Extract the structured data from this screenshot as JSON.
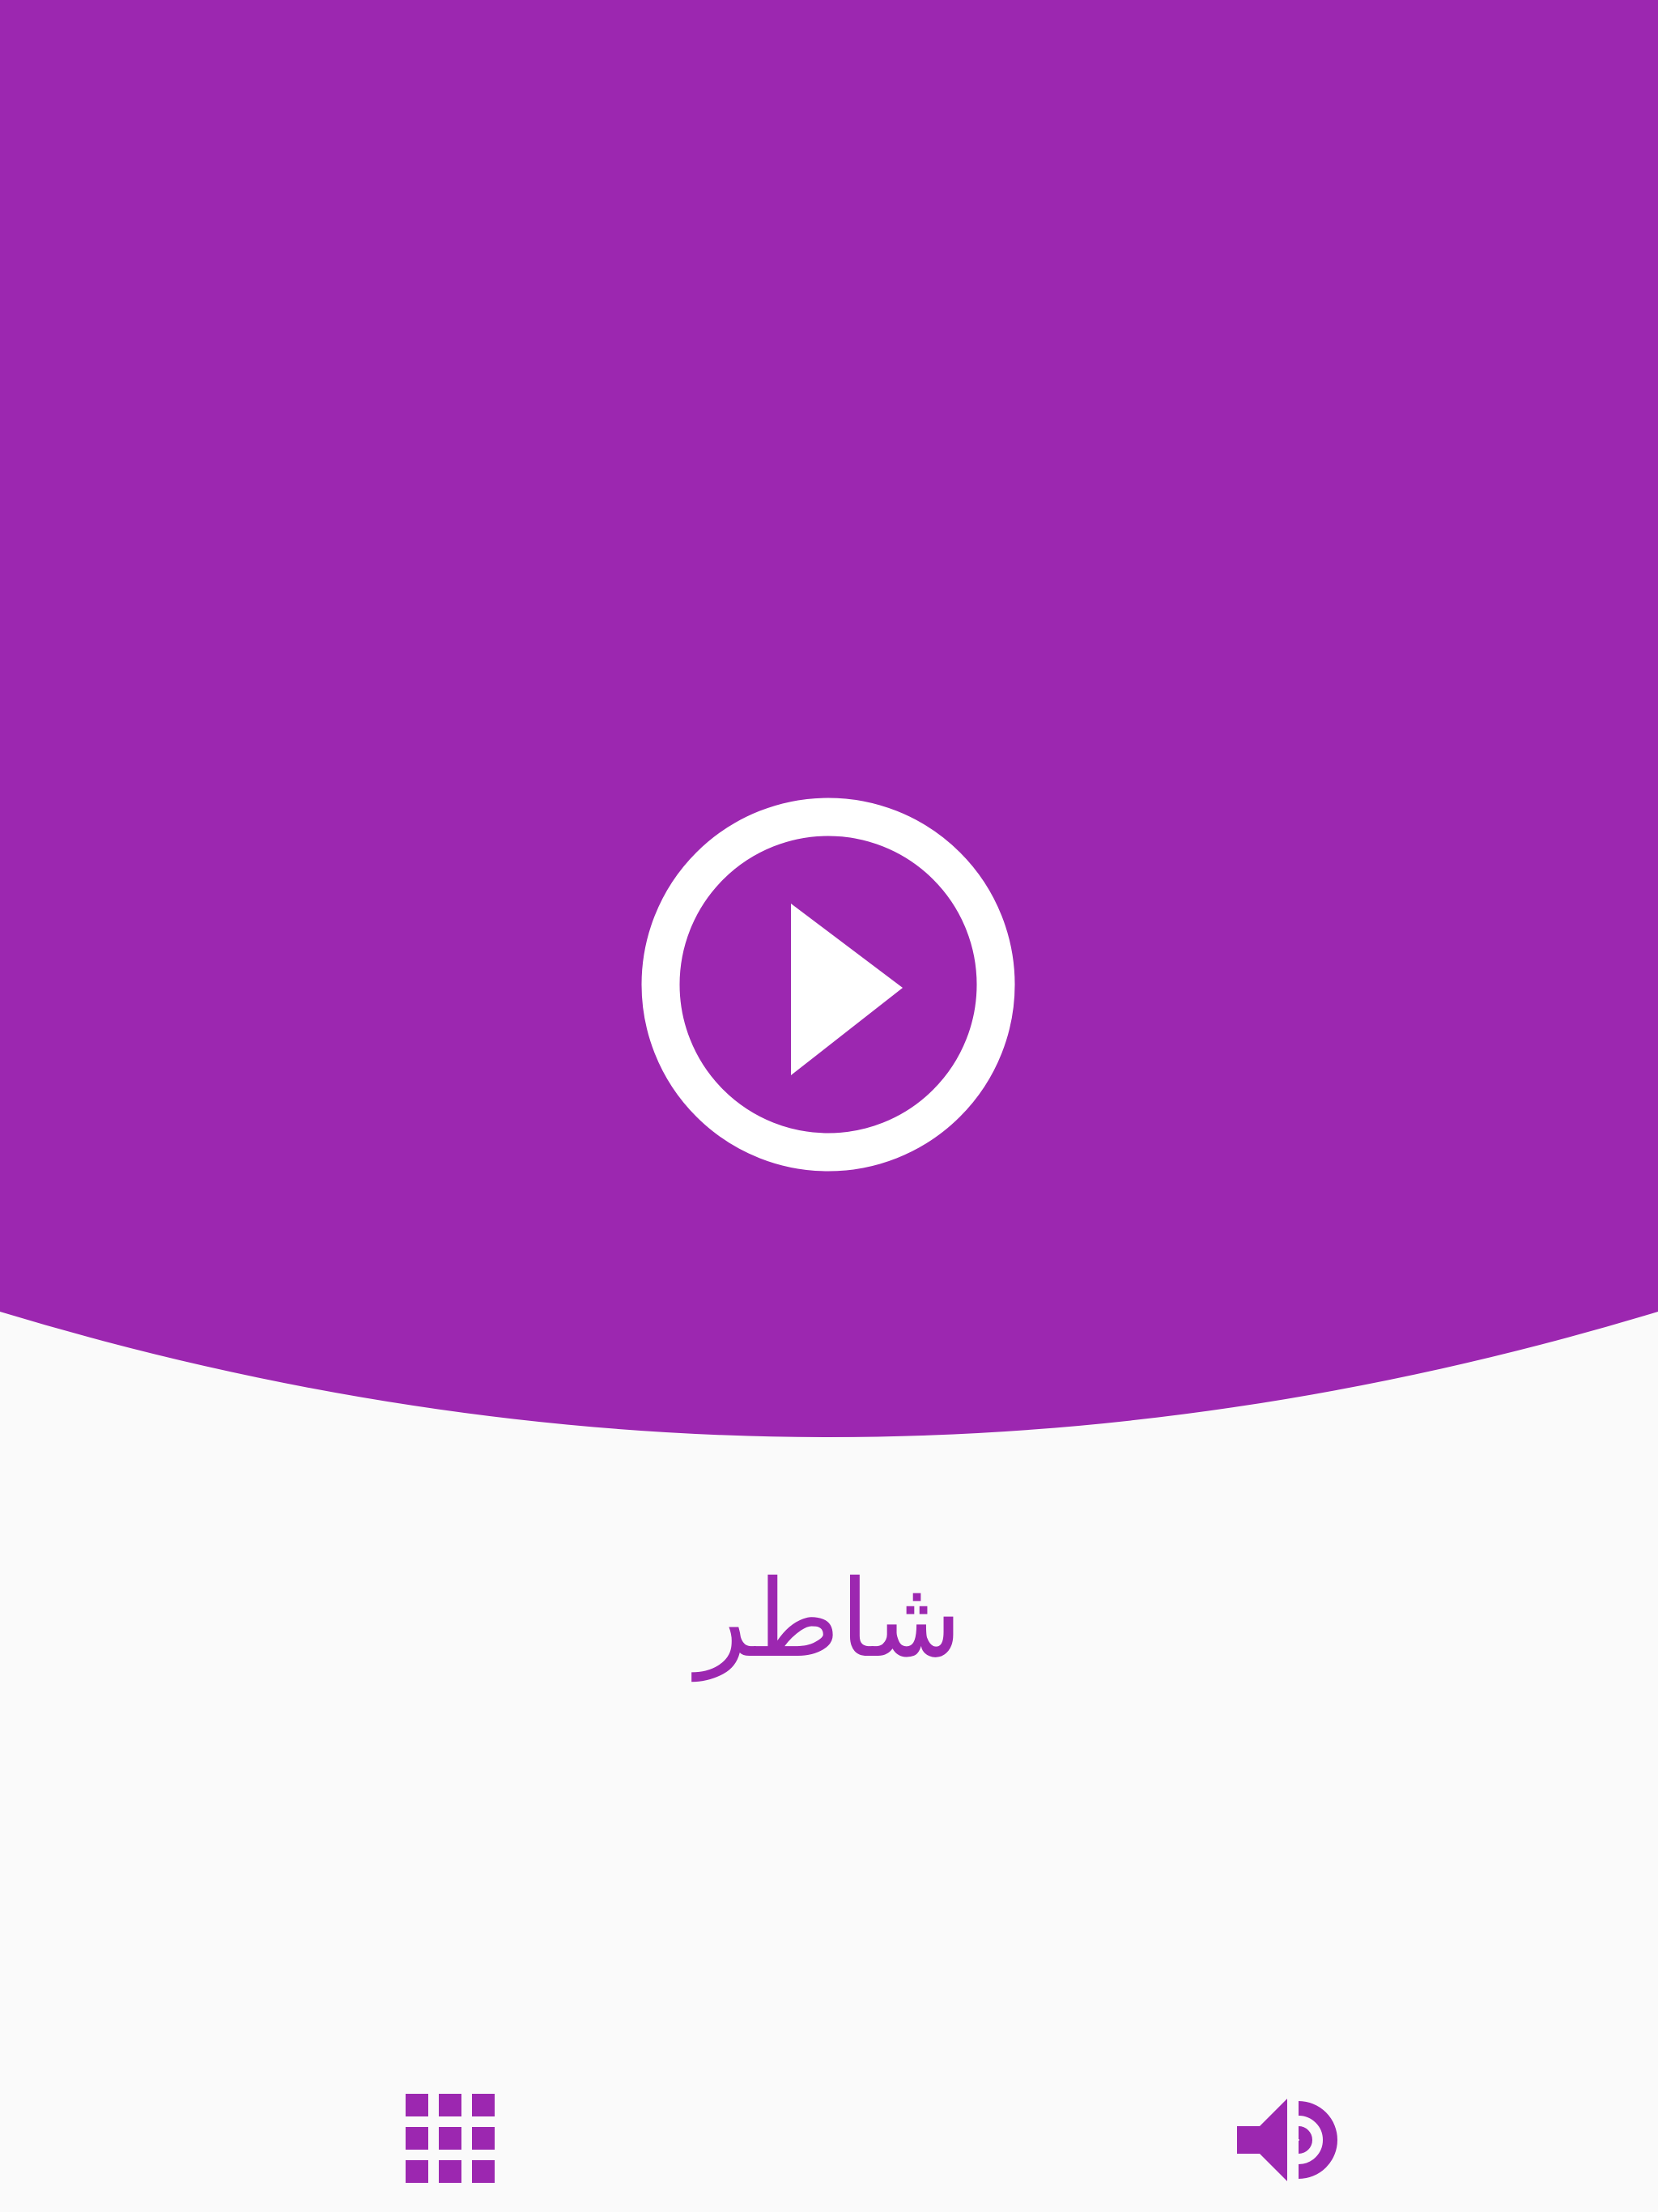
{
  "screen": {
    "word": "شاطر"
  },
  "colors": {
    "accent": "#9c27b0",
    "background": "#fafafa",
    "icon_on_accent": "#ffffff"
  },
  "icons": {
    "play": "play-circle-icon",
    "grid": "grid-icon",
    "sound": "volume-up-icon"
  }
}
